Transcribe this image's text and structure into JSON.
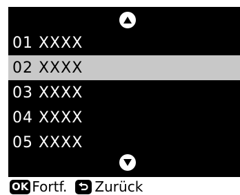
{
  "menu": {
    "scroll_up_icon": "triangle-up-icon",
    "scroll_down_icon": "triangle-down-icon",
    "items": [
      {
        "label": "01  XXXX",
        "selected": false
      },
      {
        "label": "02  XXXX",
        "selected": true
      },
      {
        "label": "03  XXXX",
        "selected": false
      },
      {
        "label": "04  XXXX",
        "selected": false
      },
      {
        "label": "05  XXXX",
        "selected": false
      }
    ]
  },
  "footer": {
    "ok_icon_text": "OK",
    "ok_label": "Fortf.",
    "back_icon": "back-arrow-icon",
    "back_label": "Zurück"
  },
  "colors": {
    "background": "#000000",
    "text": "#ffffff",
    "selection": "#c8c8c8"
  }
}
